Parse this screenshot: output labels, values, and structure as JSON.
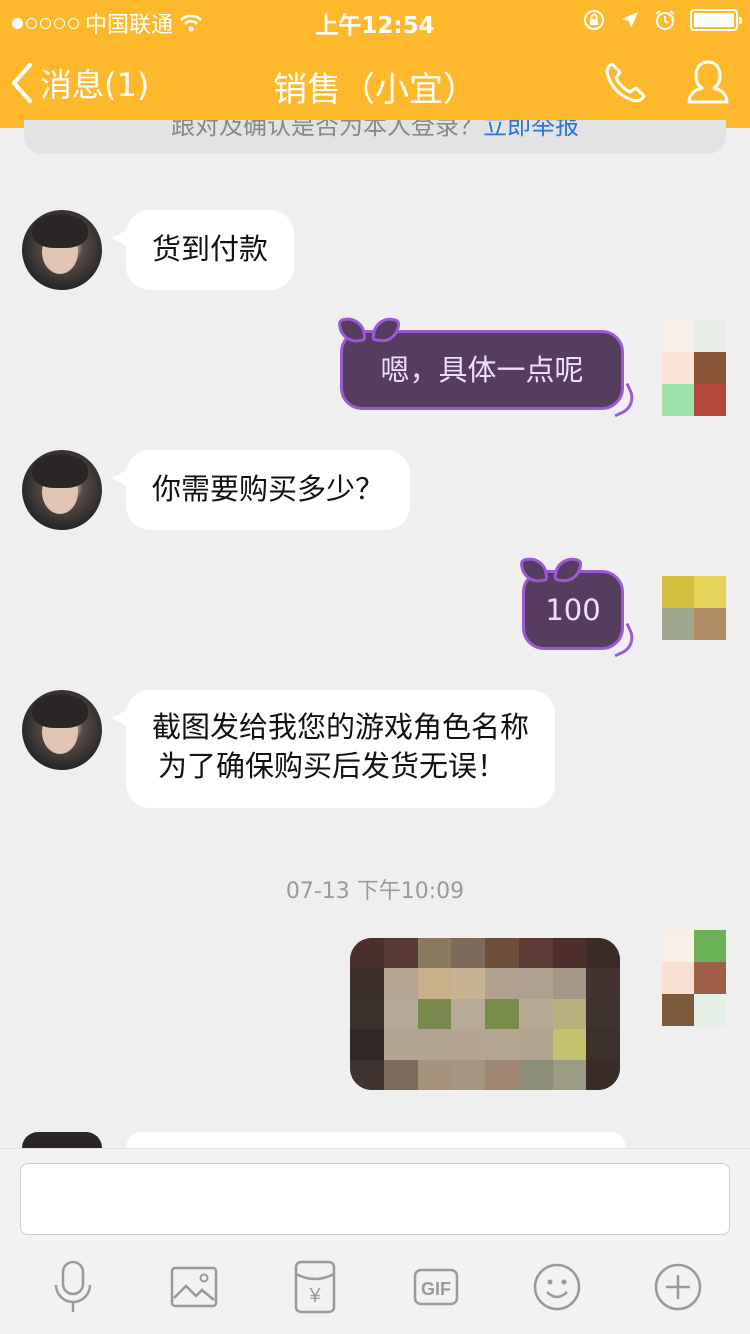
{
  "status_bar": {
    "carrier": "中国联通",
    "time": "上午12:54"
  },
  "nav": {
    "back_label": "消息(1)",
    "title": "销售（小宜）"
  },
  "banner": {
    "text": "跟对及确认是否为本人登录？",
    "link": "立即举报"
  },
  "messages": [
    {
      "side": "in",
      "text": "货到付款"
    },
    {
      "side": "out",
      "text": "嗯，具体一点呢"
    },
    {
      "side": "in",
      "text": "你需要购买多少？"
    },
    {
      "side": "out",
      "text": "100"
    },
    {
      "side": "in",
      "lines": [
        "截图发给我您的游戏角色名称",
        "为了确保购买后发货无误！"
      ]
    }
  ],
  "timestamp": "07-13 下午10:09",
  "input": {
    "placeholder": ""
  },
  "toolbar": [
    {
      "name": "microphone-icon"
    },
    {
      "name": "image-icon"
    },
    {
      "name": "red-packet-icon",
      "label": "¥"
    },
    {
      "name": "gif-icon",
      "label": "GIF"
    },
    {
      "name": "emoji-icon"
    },
    {
      "name": "plus-icon"
    }
  ],
  "colors": {
    "accent": "#fdb92b",
    "bubble_out_bg": "#563d5e",
    "bubble_out_border": "#9b59d6",
    "link": "#2a74d6"
  }
}
